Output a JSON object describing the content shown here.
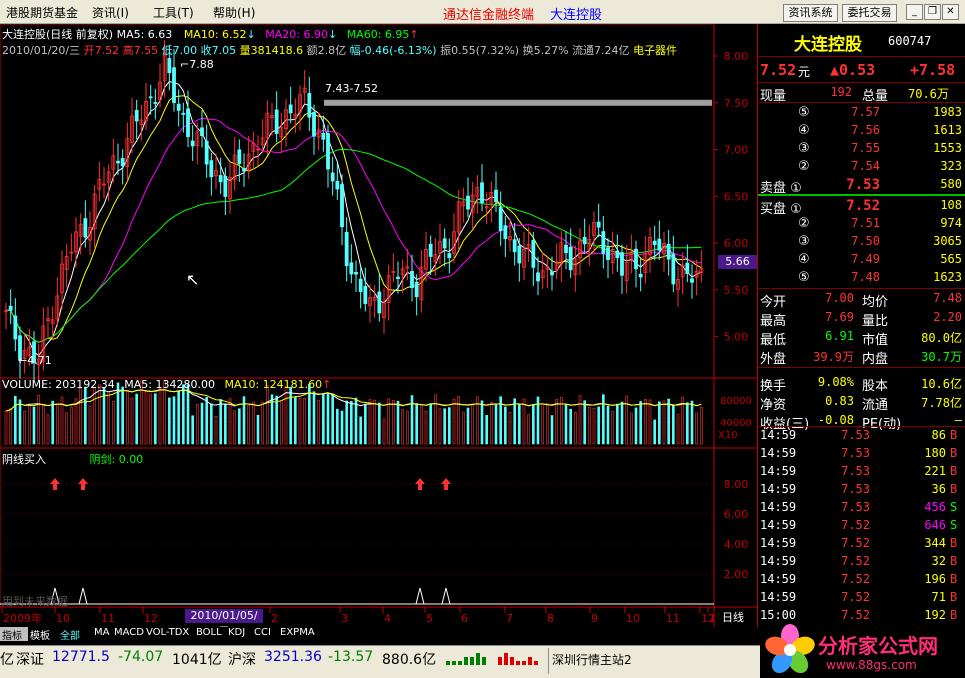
{
  "menubar": {
    "items": [
      "港股期货基金",
      "资讯(I)",
      "工具(T)",
      "帮助(H)"
    ],
    "app_title": "通达信金融终端",
    "stock_title": "大连控股",
    "buttons": [
      "资讯系统",
      "委托交易"
    ],
    "window_controls": [
      "minimize-icon",
      "restore-icon",
      "close-icon"
    ]
  },
  "chart_info": {
    "line1_name": "大连控股(日线 前复权)",
    "ma5": "MA5: 6.63",
    "ma10": "MA10: 6.52",
    "ma20": "MA20: 6.90",
    "ma60": "MA60: 6.95",
    "line2_date": "2010/01/20/三",
    "line2_open": "开7.52",
    "line2_high": "高7.55",
    "line2_low": "低7.00",
    "line2_close": "收7.05",
    "line2_vol": "量381418.6",
    "line2_amt": "额2.8亿",
    "line2_chg": "幅-0.46(-6.13%)",
    "line2_amp": "振0.55(7.32%)",
    "line2_turn": "换5.27%",
    "line2_float": "流通7.24亿",
    "line2_sector": "电子器件",
    "peak_label": "7.88",
    "range_label": "7.43-7.52",
    "low_label": "4.71",
    "cursor_price": "5.66",
    "date_tip": "2010/01/05/二",
    "volume_header": "VOLUME: 203192.34",
    "vol_ma5": "MA5: 134280.00",
    "vol_ma10": "MA10: 124181.60",
    "vol_scale": "X10",
    "ind_header": "阴线买入",
    "ind_value": "阴剑: 0.00",
    "ind_overlay": "用到未来数据",
    "period": "日线"
  },
  "chart_data": {
    "type": "candlestick",
    "price_axis": [
      5.0,
      5.5,
      6.0,
      6.5,
      7.0,
      7.5,
      8.0
    ],
    "volume_axis": [
      40000,
      80000
    ],
    "indicator_axis": [
      2.0,
      4.0,
      6.0,
      8.0
    ],
    "x_ticks": [
      "2009年",
      "10",
      "11",
      "12",
      "2",
      "3",
      "4",
      "5",
      "6",
      "7",
      "8",
      "9",
      "10",
      "11",
      "12",
      "1"
    ],
    "price_series_approx": [
      5.2,
      4.9,
      4.71,
      5.4,
      5.9,
      6.2,
      6.6,
      6.9,
      7.2,
      7.5,
      7.88,
      7.4,
      7.1,
      6.8,
      6.6,
      6.9,
      7.1,
      7.3,
      7.4,
      7.52,
      7.1,
      6.4,
      5.6,
      5.3,
      5.5,
      5.7,
      5.6,
      5.9,
      6.0,
      6.4,
      6.6,
      6.3,
      6.0,
      5.8,
      5.7,
      5.8,
      5.9,
      6.1,
      6.0,
      5.7,
      5.8,
      6.0,
      5.8,
      5.6,
      5.66
    ]
  },
  "quote": {
    "name": "大连控股",
    "code": "600747",
    "price": "7.52",
    "price_unit": "元",
    "change": "▲0.53",
    "change_pct": "+7.58",
    "labels": {
      "xianliang": "现量",
      "zongliang": "总量",
      "jinkai": "今开",
      "junjia": "均价",
      "zuigao": "最高",
      "liangbi": "量比",
      "zuidi": "最低",
      "shizhi": "市值",
      "waipan": "外盘",
      "neipan": "内盘",
      "huanshou": "换手",
      "guben": "股本",
      "jingzi": "净资",
      "liutong": "流通",
      "shouyi": "收益(三)",
      "pe": "PE(动)"
    },
    "xianliang": "192",
    "zongliang": "70.6万",
    "sell": [
      {
        "label": "⑤",
        "price": "7.57",
        "vol": "1983"
      },
      {
        "label": "④",
        "price": "7.56",
        "vol": "1613"
      },
      {
        "label": "③",
        "price": "7.55",
        "vol": "1553"
      },
      {
        "label": "②",
        "price": "7.54",
        "vol": "323"
      },
      {
        "label": "卖盘 ①",
        "price": "7.53",
        "vol": "580"
      }
    ],
    "buy": [
      {
        "label": "买盘 ①",
        "price": "7.52",
        "vol": "108"
      },
      {
        "label": "②",
        "price": "7.51",
        "vol": "974"
      },
      {
        "label": "③",
        "price": "7.50",
        "vol": "3065"
      },
      {
        "label": "④",
        "price": "7.49",
        "vol": "565"
      },
      {
        "label": "⑤",
        "price": "7.48",
        "vol": "1623"
      }
    ],
    "jinkai": "7.00",
    "junjia": "7.48",
    "zuigao": "7.69",
    "liangbi": "2.20",
    "zuidi": "6.91",
    "shizhi": "80.0亿",
    "waipan": "39.9万",
    "neipan": "30.7万",
    "huanshou": "9.08%",
    "guben": "10.6亿",
    "jingzi": "0.83",
    "liutong": "7.78亿",
    "shouyi": "-0.08",
    "pe": "—"
  },
  "ticks": [
    {
      "time": "14:59",
      "price": "7.53",
      "vol": "86",
      "side": "B"
    },
    {
      "time": "14:59",
      "price": "7.53",
      "vol": "180",
      "side": "B"
    },
    {
      "time": "14:59",
      "price": "7.53",
      "vol": "221",
      "side": "B"
    },
    {
      "time": "14:59",
      "price": "7.53",
      "vol": "36",
      "side": "B"
    },
    {
      "time": "14:59",
      "price": "7.53",
      "vol": "456",
      "side": "S"
    },
    {
      "time": "14:59",
      "price": "7.52",
      "vol": "646",
      "side": "S"
    },
    {
      "time": "14:59",
      "price": "7.52",
      "vol": "344",
      "side": "B"
    },
    {
      "time": "14:59",
      "price": "7.52",
      "vol": "32",
      "side": "B"
    },
    {
      "time": "14:59",
      "price": "7.52",
      "vol": "196",
      "side": "B"
    },
    {
      "time": "14:59",
      "price": "7.52",
      "vol": "71",
      "side": "B"
    },
    {
      "time": "15:00",
      "price": "7.52",
      "vol": "192",
      "side": "B"
    }
  ],
  "bottom_tabs": [
    "指标",
    "模板",
    "全部",
    "MA",
    "MACD",
    "VOL-TDX",
    "BOLL",
    "KDJ",
    "CCI",
    "EXPMA"
  ],
  "status": {
    "prefix": "亿",
    "sz_label": "深证",
    "sz_value": "12771.5",
    "sz_change": "-74.07",
    "sz_amount": "1041亿",
    "hs_label": "沪深",
    "hs_value": "3251.36",
    "hs_change": "-13.57",
    "hs_amount": "880.6亿",
    "server": "深圳行情主站2"
  },
  "logo": {
    "name": "分析家公式网",
    "url": "www.88gs.com"
  },
  "colors": {
    "up": "#ff3232",
    "down": "#54ffff",
    "ma5": "#ffffff",
    "ma10": "#ffff00",
    "ma20": "#ff00ff",
    "ma60": "#00ff00",
    "axis": "#c00000"
  }
}
